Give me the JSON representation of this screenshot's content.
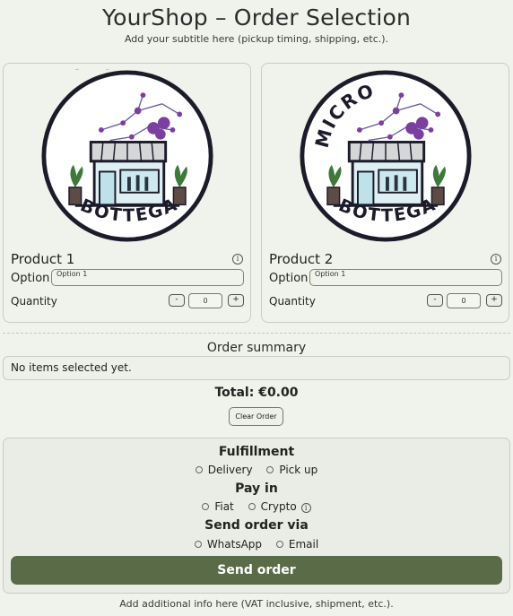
{
  "header": {
    "title": "YourShop – Order Selection",
    "subtitle": "Add your subtitle here (pickup timing, shipping, etc.)."
  },
  "logo": {
    "brand_top": "MICRO",
    "brand_bottom": "BOTTEGA"
  },
  "products": [
    {
      "name": "Product 1",
      "info_icon": "info-icon",
      "option_label": "Option",
      "option_value": "Option 1",
      "quantity_label": "Quantity",
      "quantity": "0",
      "minus": "-",
      "plus": "+"
    },
    {
      "name": "Product 2",
      "info_icon": "info-icon",
      "option_label": "Option",
      "option_value": "Option 1",
      "quantity_label": "Quantity",
      "quantity": "0",
      "minus": "-",
      "plus": "+"
    }
  ],
  "summary": {
    "title": "Order summary",
    "empty_text": "No items selected yet.",
    "total": "Total: €0.00",
    "clear_label": "Clear Order"
  },
  "checkout": {
    "fulfillment_title": "Fulfillment",
    "fulfillment_options": [
      "Delivery",
      "Pick up"
    ],
    "pay_title": "Pay in",
    "pay_options": [
      "Fiat",
      "Crypto"
    ],
    "send_via_title": "Send order via",
    "send_via_options": [
      "WhatsApp",
      "Email"
    ],
    "send_label": "Send order"
  },
  "footer": {
    "text": "Add additional info here (VAT inclusive, shipment, etc.)."
  },
  "colors": {
    "background": "#f0f2ec",
    "accent": "#5a6b47",
    "logo_purple": "#7b3fa0",
    "logo_green": "#3d7a3a"
  }
}
